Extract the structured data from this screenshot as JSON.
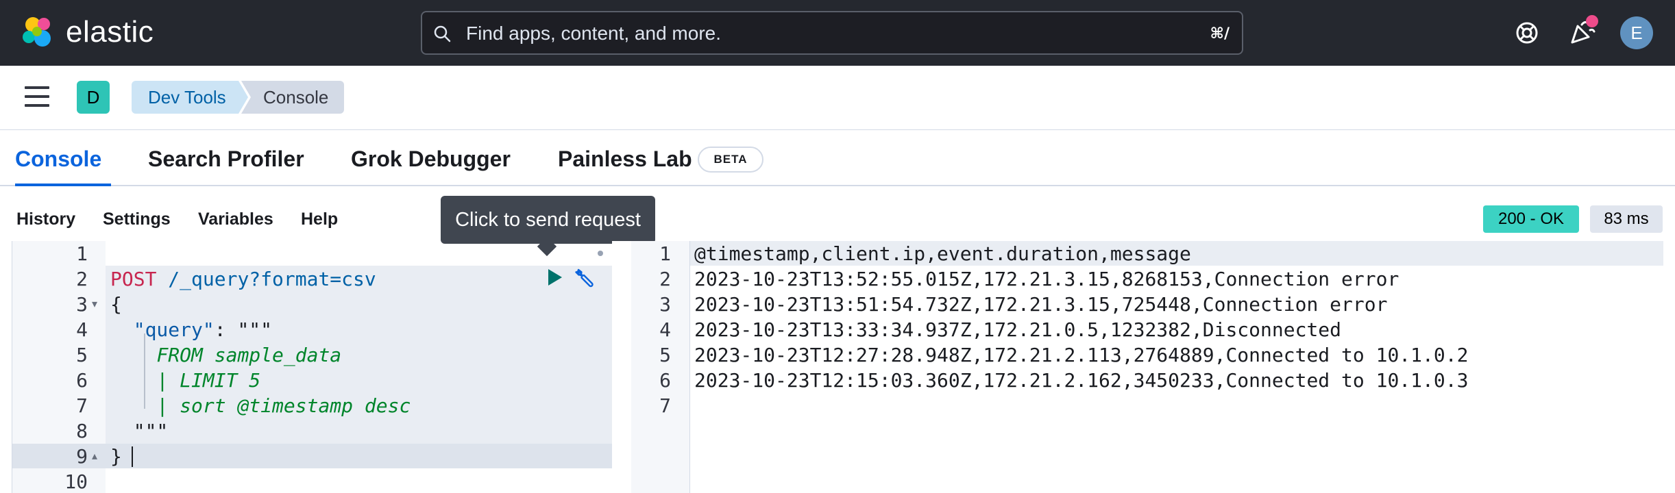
{
  "header": {
    "logo_text": "elastic",
    "search_placeholder": "Find apps, content, and more.",
    "search_shortcut": "⌘/",
    "avatar_initial": "E",
    "icons": [
      "help-icon",
      "newsfeed-icon"
    ]
  },
  "nav": {
    "space_initial": "D",
    "breadcrumbs": [
      "Dev Tools",
      "Console"
    ]
  },
  "tabs": [
    {
      "label": "Console",
      "active": true
    },
    {
      "label": "Search Profiler",
      "active": false
    },
    {
      "label": "Grok Debugger",
      "active": false
    },
    {
      "label": "Painless Lab",
      "active": false,
      "badge": "BETA"
    }
  ],
  "toolbar": {
    "items": [
      "History",
      "Settings",
      "Variables",
      "Help"
    ],
    "status": "200 - OK",
    "duration": "83 ms"
  },
  "tooltip": "Click to send request",
  "editor": {
    "line_numbers": [
      "1",
      "2",
      "3",
      "4",
      "5",
      "6",
      "7",
      "8",
      "9",
      "10"
    ],
    "method": "POST",
    "url": "/_query?format=csv",
    "lines": {
      "l3": "{",
      "l4_key": "\"query\"",
      "l4_rest": ": \"\"\"",
      "l5": "FROM sample_data",
      "l6": "| LIMIT 5",
      "l7": "| sort @timestamp desc",
      "l8": "\"\"\"",
      "l9": "}"
    }
  },
  "output": {
    "line_numbers": [
      "1",
      "2",
      "3",
      "4",
      "5",
      "6",
      "7"
    ],
    "lines": [
      "@timestamp,client.ip,event.duration,message",
      "2023-10-23T13:52:55.015Z,172.21.3.15,8268153,Connection error",
      "2023-10-23T13:51:54.732Z,172.21.3.15,725448,Connection error",
      "2023-10-23T13:33:34.937Z,172.21.0.5,1232382,Disconnected",
      "2023-10-23T12:27:28.948Z,172.21.2.113,2764889,Connected to 10.1.0.2",
      "2023-10-23T12:15:03.360Z,172.21.2.162,3450233,Connected to 10.1.0.3",
      ""
    ]
  },
  "colors": {
    "header_bg": "#25282f",
    "accent": "#0b64dd",
    "status_ok": "#3cd2c3",
    "space_badge": "#2ec4b6",
    "avatar": "#6092c0"
  }
}
